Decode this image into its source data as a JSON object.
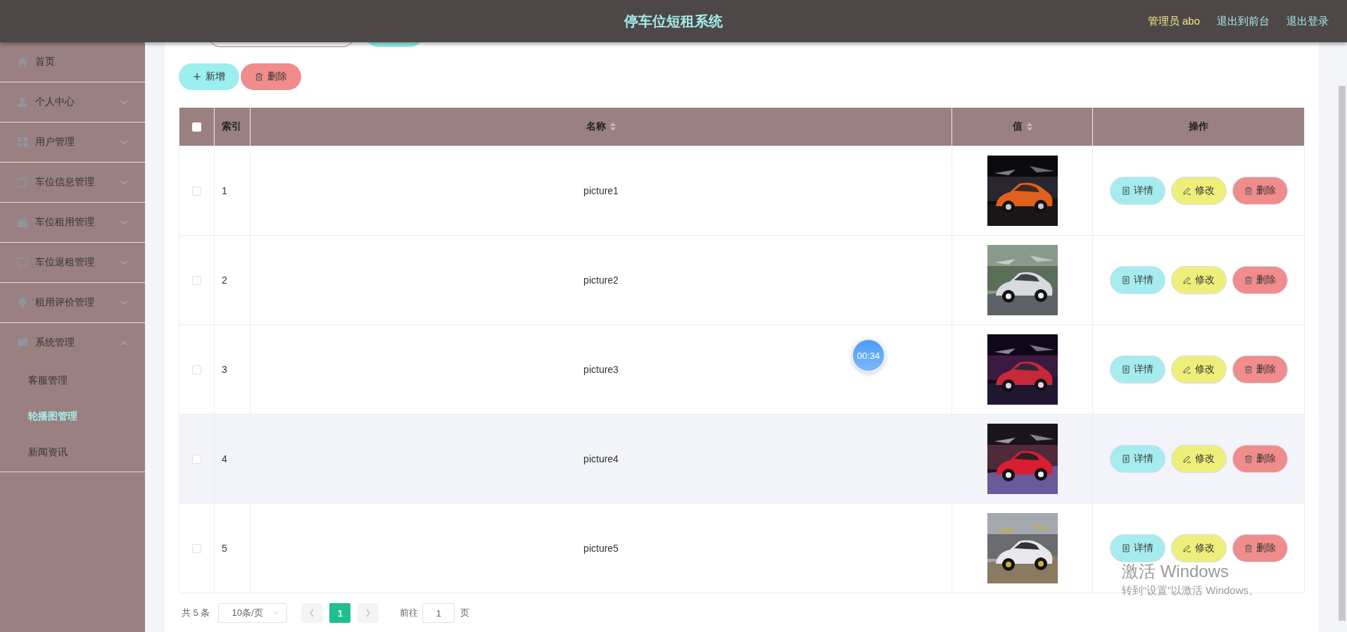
{
  "header": {
    "title": "停车位短租系统",
    "user": "管理员 abo",
    "links": [
      "退出到前台",
      "退出登录"
    ]
  },
  "sidebar": {
    "items": [
      {
        "label": "首页",
        "kind": "link"
      },
      {
        "label": "个人中心",
        "kind": "menu",
        "expanded": false
      },
      {
        "label": "用户管理",
        "kind": "menu",
        "expanded": false
      },
      {
        "label": "车位信息管理",
        "kind": "menu",
        "expanded": false
      },
      {
        "label": "车位租用管理",
        "kind": "menu",
        "expanded": false
      },
      {
        "label": "车位退租管理",
        "kind": "menu",
        "expanded": false
      },
      {
        "label": "租用评价管理",
        "kind": "menu",
        "expanded": false
      },
      {
        "label": "系统管理",
        "kind": "menu",
        "expanded": true,
        "children": [
          {
            "label": "客服管理",
            "selected": false
          },
          {
            "label": "轮播图管理",
            "selected": true
          },
          {
            "label": "新闻资讯",
            "selected": false
          }
        ]
      }
    ]
  },
  "toolbar": {
    "buttons": [
      {
        "label": "新增",
        "kind": "add"
      },
      {
        "label": "删除",
        "kind": "delete"
      }
    ]
  },
  "table": {
    "select_all": {
      "checked": false
    },
    "columns": [
      {
        "label": "索引",
        "sortable": false
      },
      {
        "label": "名称",
        "sortable": true
      },
      {
        "label": "值",
        "sortable": true
      },
      {
        "label": "操作",
        "sortable": false
      }
    ],
    "rows": [
      {
        "index": "1",
        "name": "picture1",
        "value": {
          "kind": "picture"
        },
        "checked": false,
        "highlighted": false,
        "actions": [
          {
            "label": "详情",
            "kind": "detail"
          },
          {
            "label": "修改",
            "kind": "edit"
          },
          {
            "label": "删除",
            "kind": "delete"
          }
        ]
      },
      {
        "index": "2",
        "name": "picture2",
        "value": {
          "kind": "picture"
        },
        "checked": false,
        "highlighted": false,
        "actions": [
          {
            "label": "详情",
            "kind": "detail"
          },
          {
            "label": "修改",
            "kind": "edit"
          },
          {
            "label": "删除",
            "kind": "delete"
          }
        ]
      },
      {
        "index": "3",
        "name": "picture3",
        "value": {
          "kind": "picture"
        },
        "checked": false,
        "highlighted": false,
        "actions": [
          {
            "label": "详情",
            "kind": "detail"
          },
          {
            "label": "修改",
            "kind": "edit"
          },
          {
            "label": "删除",
            "kind": "delete"
          }
        ]
      },
      {
        "index": "4",
        "name": "picture4",
        "value": {
          "kind": "picture"
        },
        "checked": false,
        "highlighted": true,
        "actions": [
          {
            "label": "详情",
            "kind": "detail"
          },
          {
            "label": "修改",
            "kind": "edit"
          },
          {
            "label": "删除",
            "kind": "delete"
          }
        ]
      },
      {
        "index": "5",
        "name": "picture5",
        "value": {
          "kind": "picture"
        },
        "checked": false,
        "highlighted": false,
        "actions": [
          {
            "label": "详情",
            "kind": "detail"
          },
          {
            "label": "修改",
            "kind": "edit"
          },
          {
            "label": "删除",
            "kind": "delete"
          }
        ]
      }
    ]
  },
  "pagination": {
    "total": "共 5 条",
    "page_size": "10条/页",
    "pages": [
      {
        "label": "1",
        "selected": true
      }
    ],
    "goto_label": "前往",
    "goto_value": "1",
    "goto_suffix": "页"
  },
  "timer": "00:34",
  "activation_notice": {
    "title": "激活 Windows",
    "text": "转到“设置”以激活 Windows。"
  }
}
